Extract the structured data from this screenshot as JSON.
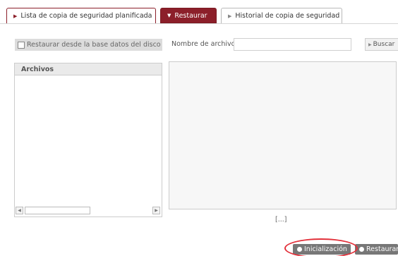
{
  "tabs": [
    {
      "label": "Lista de copia de seguridad planificada",
      "active": false
    },
    {
      "label": "Restaurar",
      "active": true
    },
    {
      "label": "Historial de copia de seguridad",
      "active": false
    }
  ],
  "toolbar": {
    "restore_from_disk_label": "Restaurar desde la base datos del disco",
    "restore_from_disk_checked": false,
    "filename_label": "Nombre de archivo",
    "filename_value": "",
    "search_label": "Buscar"
  },
  "files_panel": {
    "header": "Archivos"
  },
  "preview": {
    "ellipsis": "[...]"
  },
  "actions": {
    "init_label": "Inicialización",
    "restore_label": "Restaurar"
  },
  "colors": {
    "accent": "#8c1f2a",
    "button": "#777777",
    "highlight": "#e2303a"
  }
}
